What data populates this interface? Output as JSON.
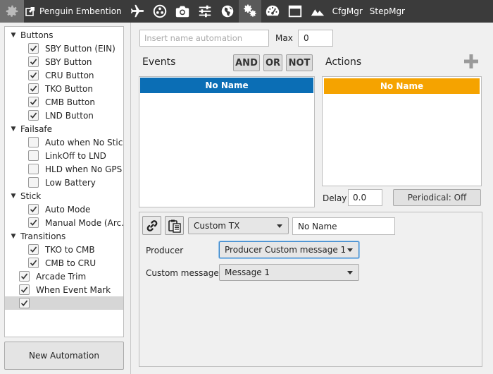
{
  "toolbar": {
    "app_title": "Penguin Embention",
    "cfgmgr_label": "CfgMgr",
    "stepmgr_label": "StepMgr",
    "icons": [
      "gear-icon",
      "external-link-icon",
      "airplane-icon",
      "joystick-icon",
      "camera-icon",
      "sliders-icon",
      "globe-icon",
      "gears-icon",
      "gauge-icon",
      "window-icon",
      "mountains-icon"
    ]
  },
  "tree": {
    "items": [
      {
        "label": "Buttons",
        "type": "group",
        "checked": null
      },
      {
        "label": "SBY Button (EIN)",
        "type": "child",
        "checked": true
      },
      {
        "label": "SBY Button",
        "type": "child",
        "checked": true
      },
      {
        "label": "CRU Button",
        "type": "child",
        "checked": true
      },
      {
        "label": "TKO Button",
        "type": "child",
        "checked": true
      },
      {
        "label": "CMB Button",
        "type": "child",
        "checked": true
      },
      {
        "label": "LND Button",
        "type": "child",
        "checked": true
      },
      {
        "label": "Failsafe",
        "type": "group",
        "checked": null
      },
      {
        "label": "Auto when No Stick",
        "type": "child",
        "checked": false
      },
      {
        "label": "LinkOff to LND",
        "type": "child",
        "checked": false
      },
      {
        "label": "HLD when No GPS",
        "type": "child",
        "checked": false
      },
      {
        "label": "Low Battery",
        "type": "child",
        "checked": false
      },
      {
        "label": "Stick",
        "type": "group",
        "checked": null
      },
      {
        "label": "Auto Mode",
        "type": "child",
        "checked": true
      },
      {
        "label": "Manual Mode (Arc…",
        "type": "child",
        "checked": true
      },
      {
        "label": "Transitions",
        "type": "group",
        "checked": null
      },
      {
        "label": "TKO to CMB",
        "type": "child",
        "checked": true
      },
      {
        "label": "CMB to CRU",
        "type": "child",
        "checked": true
      },
      {
        "label": "Arcade Trim",
        "type": "root",
        "checked": true
      },
      {
        "label": "When Event Mark",
        "type": "root",
        "checked": true
      },
      {
        "label": "",
        "type": "root",
        "checked": true,
        "selected": true
      }
    ]
  },
  "new_automation_label": "New Automation",
  "automation": {
    "name_placeholder": "Insert name automation",
    "max_label": "Max",
    "max_value": "0"
  },
  "events": {
    "label": "Events",
    "and_label": "AND",
    "or_label": "OR",
    "not_label": "NOT",
    "header": "No Name"
  },
  "actions": {
    "label": "Actions",
    "header": "No Name",
    "delay_label": "Delay",
    "delay_value": "0.0",
    "periodical_label": "Periodical: Off"
  },
  "detail": {
    "type_value": "Custom TX",
    "name_value": "No Name",
    "producer_label": "Producer",
    "producer_value": "Producer Custom message 1",
    "custom_messages_label": "Custom messages",
    "custom_messages_value": "Message 1"
  },
  "colors": {
    "events_header": "#0b6eb5",
    "actions_header": "#f5a300",
    "toolbar_bg": "#3b3b3b"
  }
}
